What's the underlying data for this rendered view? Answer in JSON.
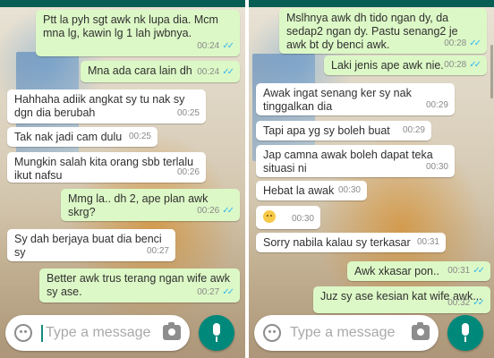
{
  "input": {
    "placeholder": "Type a message"
  },
  "icons": {
    "emoji": "smiley-icon",
    "camera": "camera-icon",
    "mic": "microphone-icon",
    "read_receipt": "double-check-icon"
  },
  "colors": {
    "outgoing_bubble": "#dcf8c6",
    "incoming_bubble": "#ffffff",
    "mic_button": "#00897b",
    "read_tick": "#34b7f1",
    "header": "#075e54"
  },
  "left": {
    "messages": [
      {
        "dir": "out",
        "text": "Ptt la pyh sgt awk nk lupa dia. Mcm\nmna lg, kawin lg 1 lah jwbnya.",
        "time": "00:24",
        "ticks": "✓✓"
      },
      {
        "dir": "out",
        "text": "Mna ada cara lain dh",
        "time": "00:24",
        "ticks": "✓✓"
      },
      {
        "dir": "in",
        "text": "Hahhaha adiik angkat sy tu nak sy\ndgn dia berubah",
        "time": "00:25"
      },
      {
        "dir": "in",
        "text": "Tak nak jadi cam dulu",
        "time": "00:25"
      },
      {
        "dir": "in",
        "text": "Mungkin salah kita orang sbb terlalu\nikut nafsu",
        "time": "00:26"
      },
      {
        "dir": "out",
        "text": "Mmg la.. dh 2, ape plan awk skrg?",
        "time": "00:26",
        "ticks": "✓✓"
      },
      {
        "dir": "in",
        "text": "Sy dah berjaya buat dia benci sy",
        "time": "00:27"
      },
      {
        "dir": "out",
        "text": "Better awk trus terang ngan wife awk\nsy ase.",
        "time": "00:27",
        "ticks": "✓✓"
      }
    ]
  },
  "right": {
    "messages": [
      {
        "dir": "out",
        "text": "Mslhnya awk dh tido ngan dy, da\nsedap2 ngan dy. Pastu senang2 je\nawk bt dy benci awk.",
        "time": "00:28",
        "ticks": "✓✓"
      },
      {
        "dir": "out",
        "text": "Laki jenis ape awk nie.",
        "time": "00:28",
        "ticks": "✓✓"
      },
      {
        "dir": "in",
        "text": "Awak ingat senang ker sy nak\ntinggalkan dia",
        "time": "00:29"
      },
      {
        "dir": "in",
        "text": "Tapi apa yg sy boleh buat",
        "time": "00:29"
      },
      {
        "dir": "in",
        "text": "Jap camna awak boleh dapat teka\nsituasi ni",
        "time": "00:30"
      },
      {
        "dir": "in",
        "text": "Hebat la awak",
        "time": "00:30"
      },
      {
        "dir": "in",
        "emoji": "worried-face-emoji",
        "time": "00:30"
      },
      {
        "dir": "in",
        "text": "Sorry nabila kalau sy terkasar",
        "time": "00:31"
      },
      {
        "dir": "out",
        "text": "Awk xkasar pon..",
        "time": "00:31",
        "ticks": "✓✓"
      },
      {
        "dir": "out",
        "text": "Juz sy ase kesian kat wife awk...",
        "time": "00:32",
        "ticks": "✓✓"
      }
    ]
  }
}
